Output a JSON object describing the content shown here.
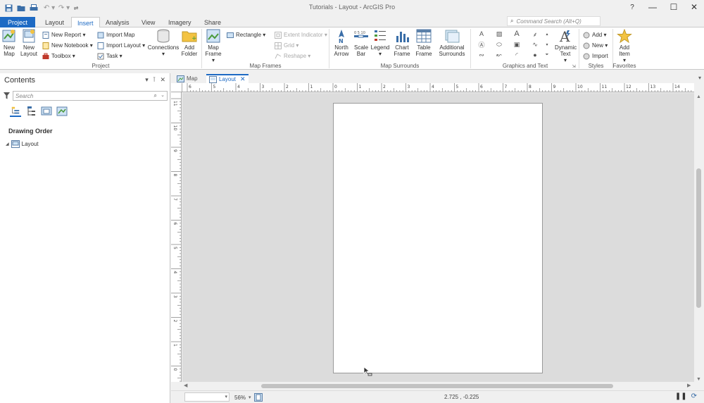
{
  "window": {
    "title": "Tutorials - Layout - ArcGIS Pro",
    "help": "?",
    "minimize": "—",
    "maximize": "☐",
    "close": "✕"
  },
  "quick_access": [
    "save-icon",
    "open-icon",
    "print-icon",
    "undo-icon",
    "redo-icon",
    "customize-icon"
  ],
  "tabs": [
    "Project",
    "Layout",
    "Insert",
    "Analysis",
    "View",
    "Imagery",
    "Share"
  ],
  "active_tab": "Insert",
  "command_search": {
    "placeholder": "Command Search (Alt+Q)"
  },
  "ribbon": {
    "project": {
      "label": "Project",
      "new_map": "New Map",
      "new_layout": "New Layout",
      "new_report": "New Report",
      "new_notebook": "New Notebook",
      "toolbox": "Toolbox",
      "import_map": "Import Map",
      "import_layout": "Import Layout",
      "task": "Task",
      "connections": "Connections",
      "add_folder": "Add Folder"
    },
    "map_frames": {
      "label": "Map Frames",
      "map_frame": "Map Frame",
      "rectangle": "Rectangle",
      "extent_indicator": "Extent Indicator",
      "grid": "Grid",
      "reshape": "Reshape"
    },
    "map_surrounds": {
      "label": "Map Surrounds",
      "north_arrow": "North Arrow",
      "scale_bar": "Scale Bar",
      "legend": "Legend",
      "chart_frame": "Chart Frame",
      "table_frame": "Table Frame",
      "additional_surrounds": "Additional Surrounds"
    },
    "graphics_text": {
      "label": "Graphics and Text",
      "dynamic_text": "Dynamic Text"
    },
    "styles": {
      "label": "Styles",
      "add": "Add",
      "new": "New",
      "import": "Import"
    },
    "favorites": {
      "label": "Favorites",
      "add_item": "Add Item"
    }
  },
  "contents": {
    "title": "Contents",
    "search_placeholder": "Search",
    "drawing_order": "Drawing Order",
    "item": "Layout"
  },
  "view_tabs": [
    {
      "label": "Map",
      "active": false
    },
    {
      "label": "Layout",
      "active": true
    }
  ],
  "ruler": {
    "h_labels": [
      "6",
      "5",
      "4",
      "3",
      "2",
      "1",
      "0",
      "1",
      "2",
      "3",
      "4",
      "5",
      "6",
      "7",
      "8",
      "9",
      "10",
      "11",
      "12",
      "13",
      "14"
    ],
    "v_labels": [
      "11",
      "10",
      "9",
      "8",
      "7",
      "6",
      "5",
      "4",
      "3",
      "2",
      "1",
      "0"
    ]
  },
  "status": {
    "zoom": "56%",
    "coords": "2.725 , -0.225"
  },
  "colors": {
    "accent": "#1d6ac4",
    "canvas": "#dcdcdc"
  }
}
